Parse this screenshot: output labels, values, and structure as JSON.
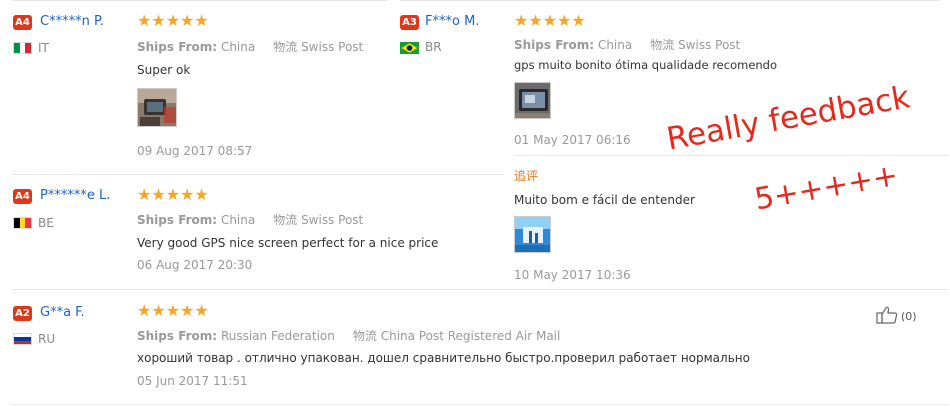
{
  "reviews": [
    {
      "badge": "A4",
      "name": "C*****n P.",
      "country": "IT",
      "stars": "★★★★★",
      "rating": 5,
      "ships_label": "Ships From:",
      "ships_value": "China",
      "logistics_label": "物流",
      "logistics_value": "Swiss Post",
      "text": "Super ok",
      "date": "09 Aug 2017 08:57"
    },
    {
      "badge": "A3",
      "name": "F***o M.",
      "country": "BR",
      "stars": "★★★★★",
      "rating": 5,
      "ships_label": "Ships From:",
      "ships_value": "China",
      "logistics_label": "物流",
      "logistics_value": "Swiss Post",
      "text": "gps muito bonito ótima qualidade recomendo",
      "date": "01 May 2017 06:16",
      "additional_label": "追评",
      "additional_text": "Muito bom e fácil de entender",
      "additional_date": "10 May 2017 10:36"
    },
    {
      "badge": "A4",
      "name": "P******e L.",
      "country": "BE",
      "stars": "★★★★★",
      "rating": 5,
      "ships_label": "Ships From:",
      "ships_value": "China",
      "logistics_label": "物流",
      "logistics_value": "Swiss Post",
      "text": "Very good GPS nice screen perfect for a nice price",
      "date": "06 Aug 2017 20:30"
    },
    {
      "badge": "A2",
      "name": "G**a F.",
      "country": "RU",
      "stars": "★★★★★",
      "rating": 5,
      "ships_label": "Ships From:",
      "ships_value": "Russian Federation",
      "logistics_label": "物流",
      "logistics_value": "China Post Registered Air Mail",
      "text": "хороший товар . отлично упакован. дошел сравнительно быстро.проверил работает нормально",
      "date": "05 Jun 2017 11:51",
      "helpful_count": "(0)"
    }
  ],
  "overlay": {
    "line1": "Really feedback",
    "line2": "5+++++"
  },
  "colors": {
    "badge": "#e0371b",
    "name": "#1b63c7",
    "stars": "#f5a623",
    "overlay": "#e42a1f",
    "additional_label": "#e8761a"
  }
}
